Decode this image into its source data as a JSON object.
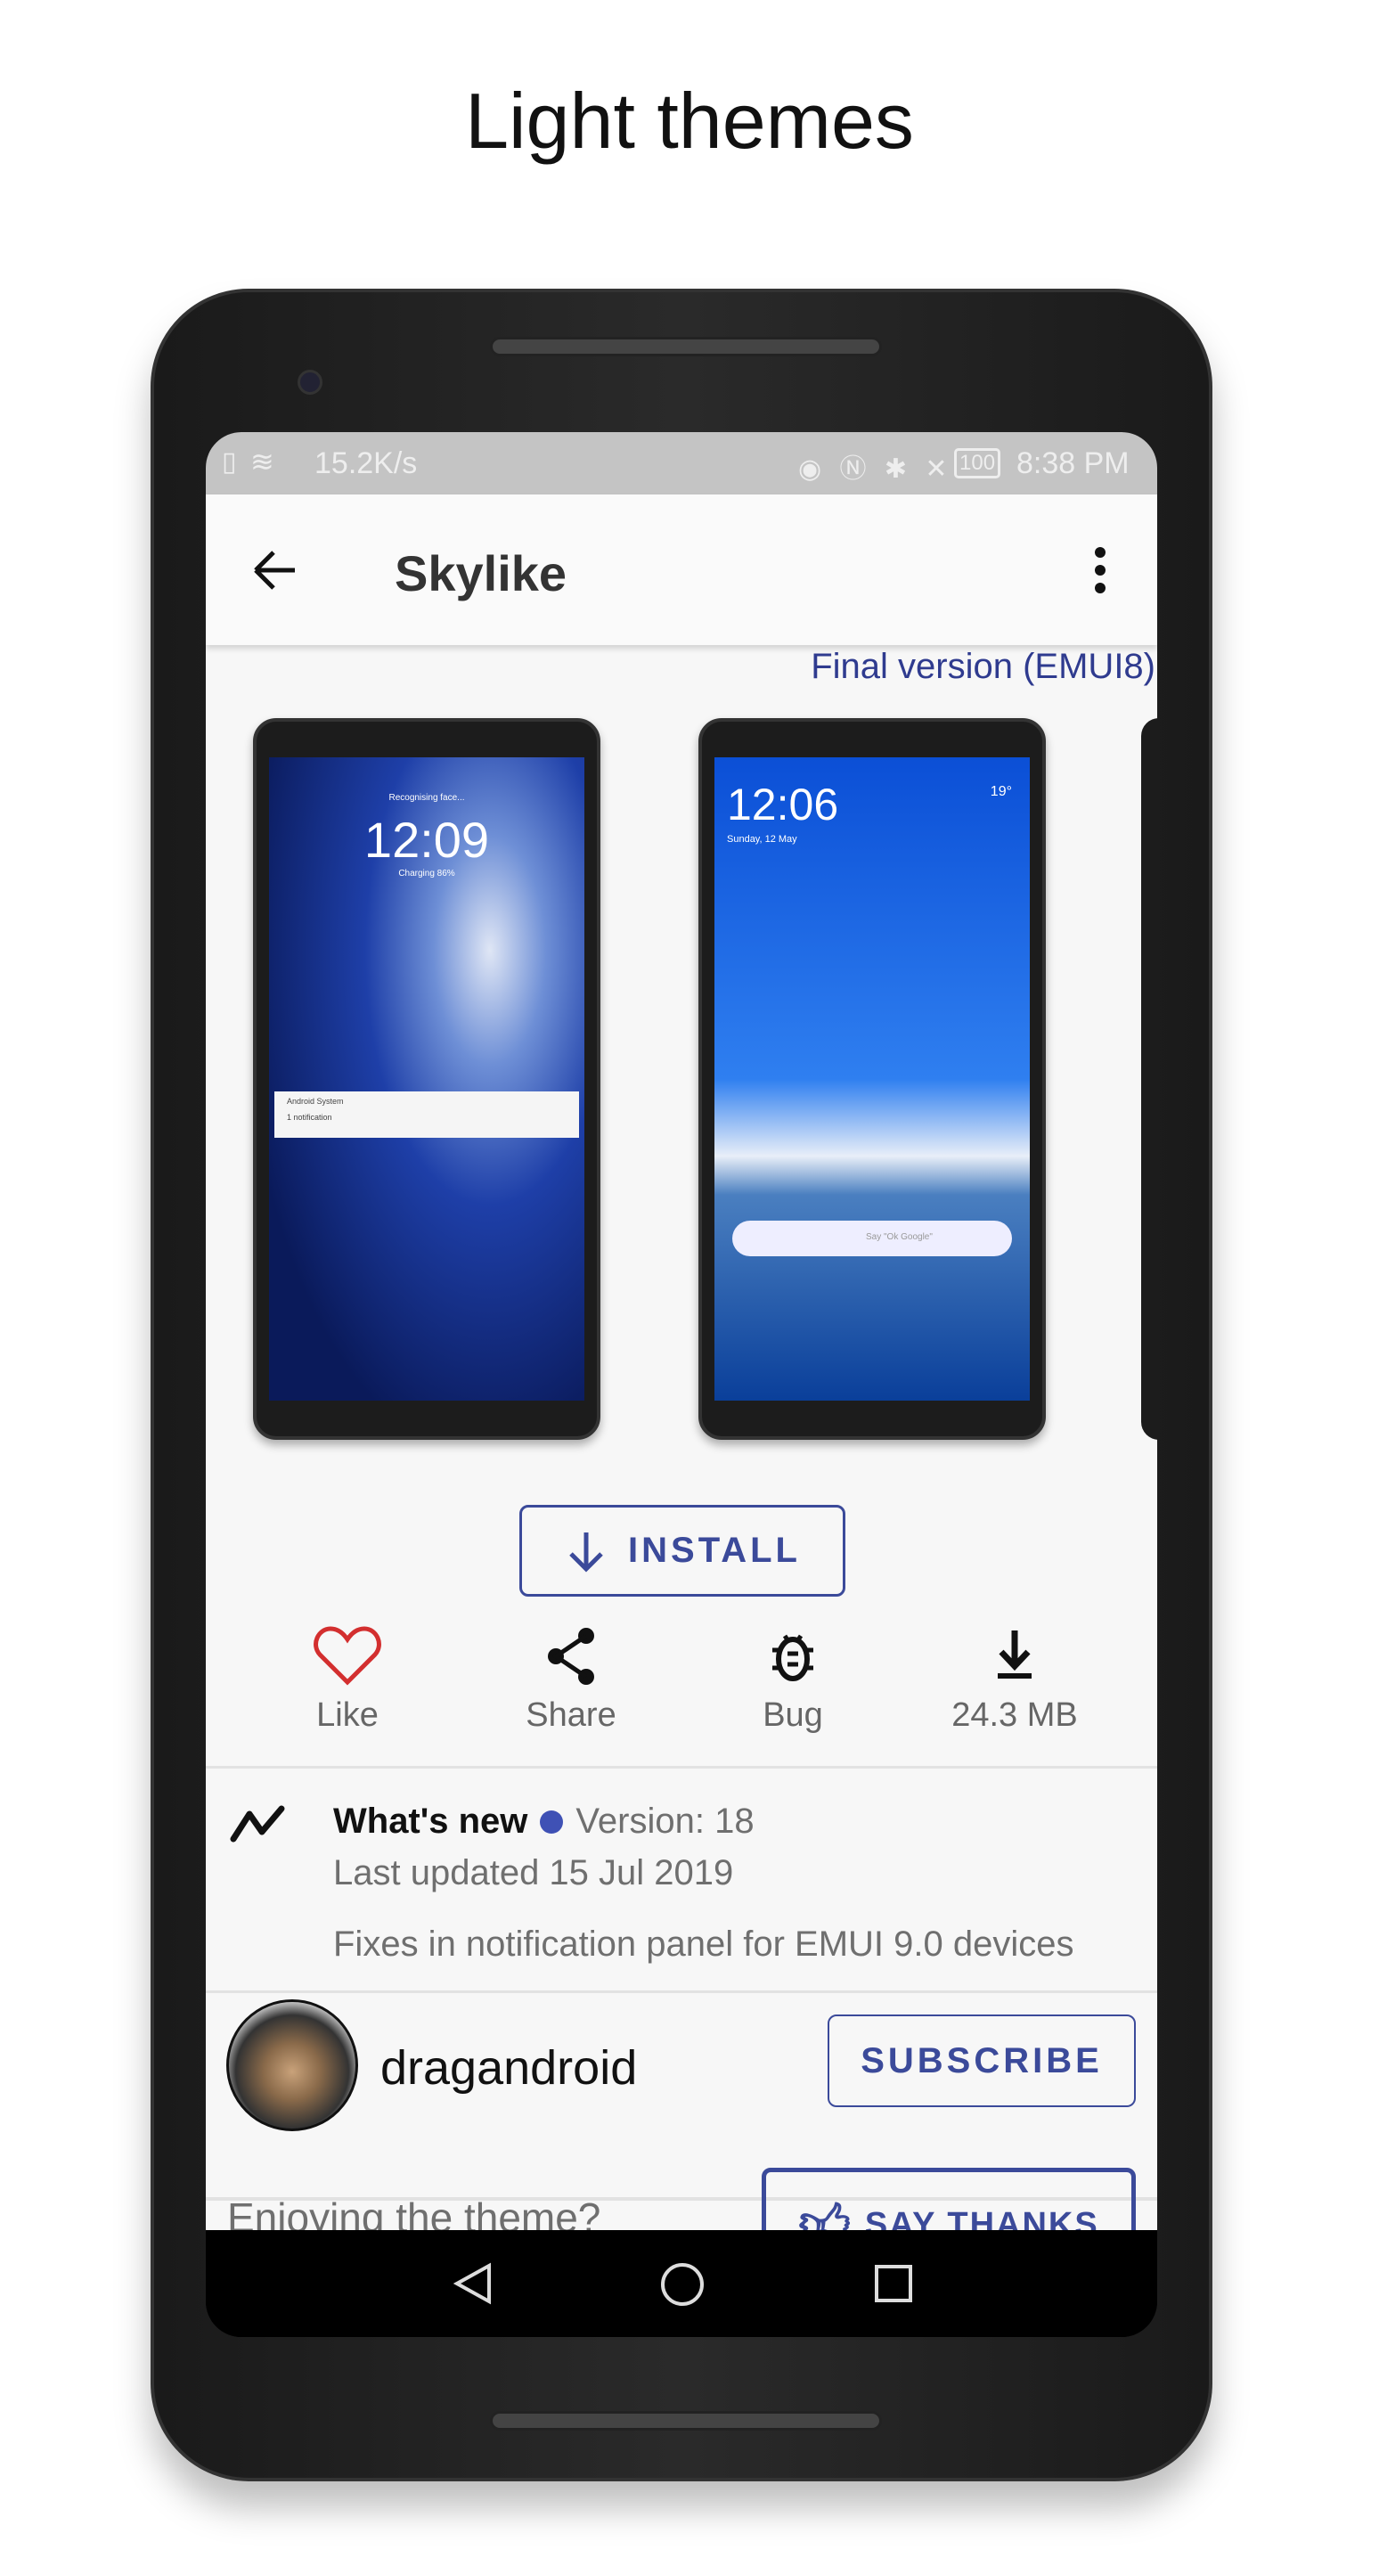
{
  "headline": "Light themes",
  "status_bar": {
    "network_speed": "15.2K/s",
    "battery": "100",
    "time": "8:38 PM"
  },
  "app_bar": {
    "title": "Skylike",
    "back_icon": "arrow-left-icon",
    "menu_icon": "more-vert-icon"
  },
  "version_label": "Final version (EMUI8)",
  "preview1": {
    "time": "12:09",
    "sub": "Charging 86%",
    "top": "Recognising face...",
    "notif_title": "Android System",
    "notif_body": "1 notification"
  },
  "preview2": {
    "time": "12:06",
    "date": "Sunday, 12 May",
    "weather": "19°",
    "search_hint": "Say \"Ok Google\""
  },
  "install_label": "INSTALL",
  "actions": [
    {
      "label": "Like",
      "icon": "heart-outline-icon",
      "color": "#d32f2f"
    },
    {
      "label": "Share",
      "icon": "share-icon"
    },
    {
      "label": "Bug",
      "icon": "bug-icon"
    },
    {
      "label": "24.3 MB",
      "icon": "download-icon"
    }
  ],
  "whats_new": {
    "title": "What's new",
    "version": "Version: 18",
    "updated": "Last updated 15 Jul 2019",
    "notes": "Fixes in notification panel for EMUI 9.0 devices",
    "dot_color": "#3f51b5"
  },
  "author": {
    "name": "dragandroid",
    "subscribe_label": "SUBSCRIBE"
  },
  "thanks": {
    "prompt": "Enjoying the theme?",
    "button_label": "SAY THANKS"
  },
  "accent": "#3b4a9a"
}
